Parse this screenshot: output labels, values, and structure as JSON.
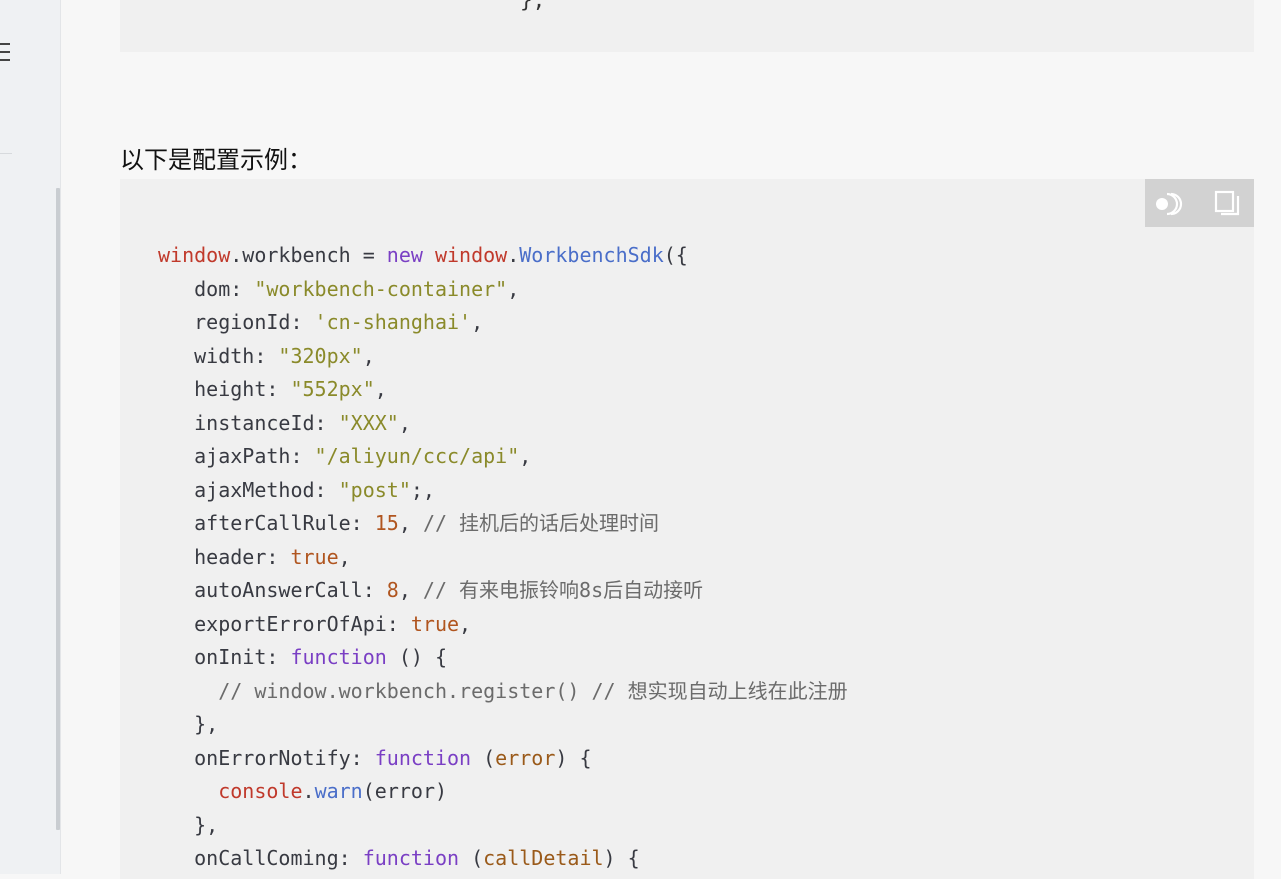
{
  "previous_code_tail": "};",
  "heading": "以下是配置示例：",
  "toolbar": {
    "run_icon": "run-toggle-icon",
    "copy_icon": "copy-icon"
  },
  "code_lines": [
    [
      [
        "window",
        "var"
      ],
      [
        ".",
        "plain"
      ],
      [
        "workbench",
        "plain"
      ],
      [
        " = ",
        "plain"
      ],
      [
        "new",
        "kw"
      ],
      [
        " ",
        "plain"
      ],
      [
        "window",
        "var"
      ],
      [
        ".",
        "plain"
      ],
      [
        "WorkbenchSdk",
        "cls"
      ],
      [
        "({",
        "plain"
      ]
    ],
    [
      [
        "   dom: ",
        "plain"
      ],
      [
        "\"workbench-container\"",
        "str"
      ],
      [
        ",",
        "plain"
      ]
    ],
    [
      [
        "   regionId: ",
        "plain"
      ],
      [
        "'cn-shanghai'",
        "str"
      ],
      [
        ",",
        "plain"
      ]
    ],
    [
      [
        "   width: ",
        "plain"
      ],
      [
        "\"320px\"",
        "str"
      ],
      [
        ",",
        "plain"
      ]
    ],
    [
      [
        "   height: ",
        "plain"
      ],
      [
        "\"552px\"",
        "str"
      ],
      [
        ",",
        "plain"
      ]
    ],
    [
      [
        "   instanceId: ",
        "plain"
      ],
      [
        "\"XXX\"",
        "str"
      ],
      [
        ",",
        "plain"
      ]
    ],
    [
      [
        "   ajaxPath: ",
        "plain"
      ],
      [
        "\"/aliyun/ccc/api\"",
        "str"
      ],
      [
        ",",
        "plain"
      ]
    ],
    [
      [
        "   ajaxMethod: ",
        "plain"
      ],
      [
        "\"post\"",
        "str"
      ],
      [
        ";,",
        "plain"
      ]
    ],
    [
      [
        "   afterCallRule: ",
        "plain"
      ],
      [
        "15",
        "num"
      ],
      [
        ", ",
        "plain"
      ],
      [
        "// 挂机后的话后处理时间",
        "cm"
      ]
    ],
    [
      [
        "   header: ",
        "plain"
      ],
      [
        "true",
        "num"
      ],
      [
        ",",
        "plain"
      ]
    ],
    [
      [
        "   autoAnswerCall: ",
        "plain"
      ],
      [
        "8",
        "num"
      ],
      [
        ", ",
        "plain"
      ],
      [
        "// 有来电振铃响8s后自动接听",
        "cm"
      ]
    ],
    [
      [
        "   exportErrorOfApi: ",
        "plain"
      ],
      [
        "true",
        "num"
      ],
      [
        ",",
        "plain"
      ]
    ],
    [
      [
        "   onInit: ",
        "plain"
      ],
      [
        "function",
        "kw"
      ],
      [
        " () {",
        "plain"
      ]
    ],
    [
      [
        "     ",
        "plain"
      ],
      [
        "// window.workbench.register() // 想实现自动上线在此注册",
        "cm"
      ]
    ],
    [
      [
        "   },",
        "plain"
      ]
    ],
    [
      [
        "   onErrorNotify: ",
        "plain"
      ],
      [
        "function",
        "kw"
      ],
      [
        " (",
        "plain"
      ],
      [
        "error",
        "param"
      ],
      [
        ") {",
        "plain"
      ]
    ],
    [
      [
        "     ",
        "plain"
      ],
      [
        "console",
        "var"
      ],
      [
        ".",
        "plain"
      ],
      [
        "warn",
        "fn"
      ],
      [
        "(error)",
        "plain"
      ]
    ],
    [
      [
        "   },",
        "plain"
      ]
    ],
    [
      [
        "   onCallComing: ",
        "plain"
      ],
      [
        "function",
        "kw"
      ],
      [
        " (",
        "plain"
      ],
      [
        "callDetail",
        "param"
      ],
      [
        ") {",
        "plain"
      ]
    ]
  ]
}
